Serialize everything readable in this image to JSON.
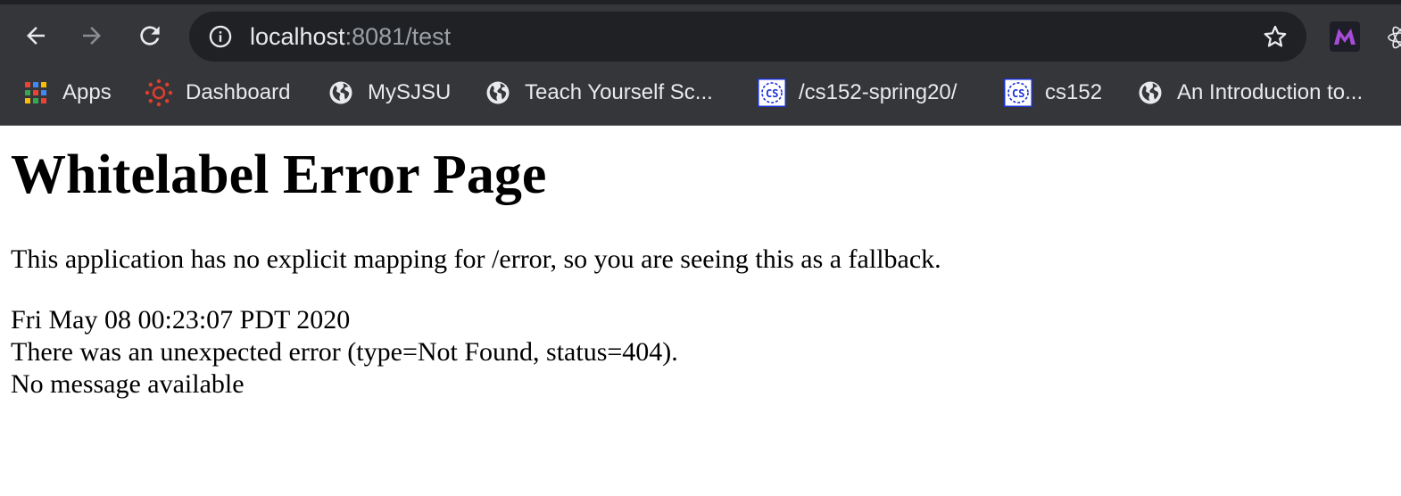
{
  "browser": {
    "url": {
      "host": "localhost",
      "rest": ":8081/test"
    },
    "icons": {
      "back": "arrow-left-icon",
      "forward": "arrow-right-icon",
      "reload": "reload-icon",
      "site_info": "info-icon",
      "bookmark_star": "star-icon",
      "extension_1": "m-extension-icon",
      "extension_2": "atom-extension-icon"
    },
    "bookmarks": [
      {
        "label": "Apps",
        "icon": "apps-grid-icon"
      },
      {
        "label": "Dashboard",
        "icon": "canvas-icon"
      },
      {
        "label": "MySJSU",
        "icon": "globe-icon"
      },
      {
        "label": "Teach Yourself Sc...",
        "icon": "globe-icon"
      },
      {
        "label": "/cs152-spring20/",
        "icon": "cs-favicon-icon"
      },
      {
        "label": "cs152",
        "icon": "cs-favicon-icon"
      },
      {
        "label": "An Introduction to...",
        "icon": "globe-icon"
      }
    ],
    "colors": {
      "toolbar": "#35363a",
      "omnibox": "#202124",
      "text": "#e8eaed",
      "muted": "#9aa0a6"
    }
  },
  "page": {
    "title": "Whitelabel Error Page",
    "description": "This application has no explicit mapping for /error, so you are seeing this as a fallback.",
    "timestamp": "Fri May 08 00:23:07 PDT 2020",
    "error_line": "There was an unexpected error (type=Not Found, status=404).",
    "message": "No message available"
  }
}
